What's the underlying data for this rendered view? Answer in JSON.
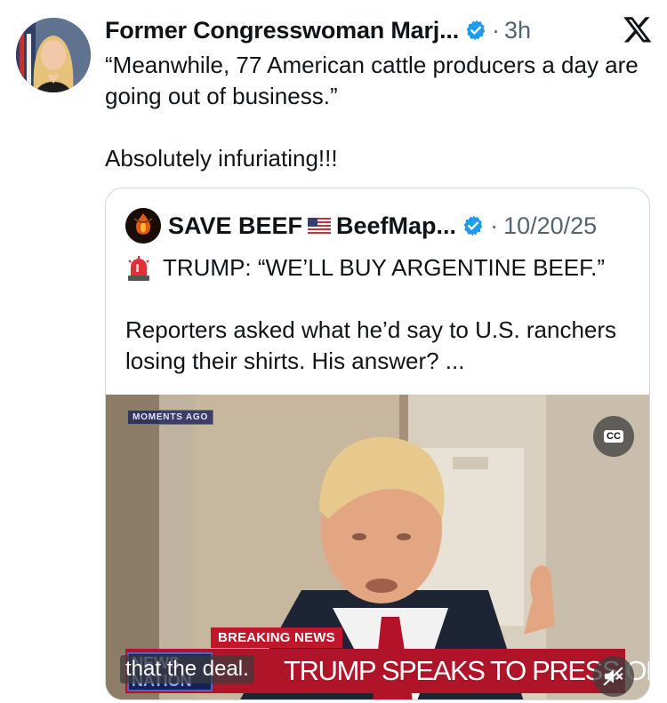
{
  "tweet": {
    "author_name": "Former Congresswoman Marj...",
    "separator": "·",
    "time": "3h",
    "text_line1": "“Meanwhile, 77 American cattle producers a day are going out of business.”",
    "text_line2": "Absolutely infuriating!!!"
  },
  "quote": {
    "author_name": "SAVE BEEF",
    "handle": "BeefMap...",
    "separator": "·",
    "date": "10/20/25",
    "text_line1": "TRUMP: “WE’LL BUY ARGENTINE BEEF.”",
    "text_line2": "Reporters asked what he’d say to U.S. ranchers losing their shirts. His answer? ..."
  },
  "video": {
    "badge": "MOMENTS AGO",
    "cc_label": "CC",
    "breaking": "BREAKING NEWS",
    "network": "NEWS NATION",
    "chyron": "TRUMP SPEAKS TO PRESS ON AIR FORCE ONE",
    "caption": "that the deal."
  },
  "colors": {
    "verified_blue": "#1d9bf0",
    "text_primary": "#0f1419",
    "text_secondary": "#536471",
    "chyron_red": "#b01428"
  },
  "icons": [
    "verified-badge-icon",
    "x-logo-icon",
    "us-flag-icon",
    "siren-icon",
    "cc-icon",
    "mute-icon"
  ]
}
